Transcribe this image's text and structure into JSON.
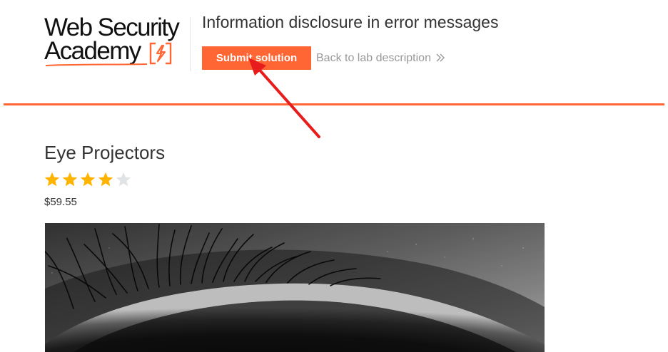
{
  "header": {
    "logo": {
      "line1": "Web Security",
      "line2": "Academy"
    },
    "lab_title": "Information disclosure in error messages",
    "submit_label": "Submit solution",
    "back_link_label": "Back to lab description",
    "accent_color": "#ff6633"
  },
  "product": {
    "title": "Eye Projectors",
    "rating": 4,
    "rating_max": 5,
    "price": "$59.55",
    "star_filled_color": "#ffb400",
    "star_empty_color": "#e1e4e6"
  },
  "annotation": {
    "arrow_color": "#e81c1c"
  }
}
